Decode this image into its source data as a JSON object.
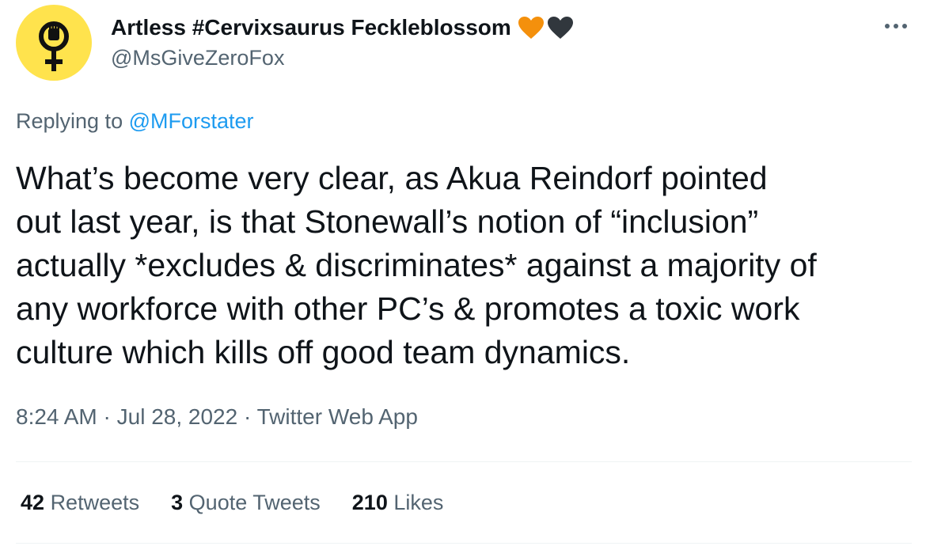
{
  "author": {
    "display_name": "Artless #Cervixsaurus Feckleblossom",
    "handle": "@MsGiveZeroFox",
    "avatar_icon": "female-symbol-raised-fist-icon",
    "avatar_color": "#ffe34d",
    "name_emojis": [
      {
        "icon": "orange-heart-icon",
        "color": "#f4900c"
      },
      {
        "icon": "black-heart-icon",
        "color": "#31373d"
      }
    ]
  },
  "more_icon": "more-options-icon",
  "reply_context": {
    "prefix": "Replying to",
    "mention": "@MForstater"
  },
  "tweet": {
    "lines": [
      "What’s become very clear, as Akua Reindorf pointed",
      "out last year, is that Stonewall’s notion of “inclusion”",
      "actually *excludes & discriminates* against a majority of",
      "any workforce with other PC’s & promotes a toxic work",
      "culture which kills off good team dynamics."
    ]
  },
  "meta": {
    "time": "8:24 AM",
    "separator": " · ",
    "date": "Jul 28, 2022",
    "source": "Twitter Web App"
  },
  "stats": {
    "retweets": {
      "count": "42",
      "label": "Retweets"
    },
    "quote_tweets": {
      "count": "3",
      "label": "Quote Tweets"
    },
    "likes": {
      "count": "210",
      "label": "Likes"
    }
  },
  "colors": {
    "text": "#0f1419",
    "secondary": "#536471",
    "link": "#1d9bf0",
    "divider": "#eff3f4"
  }
}
